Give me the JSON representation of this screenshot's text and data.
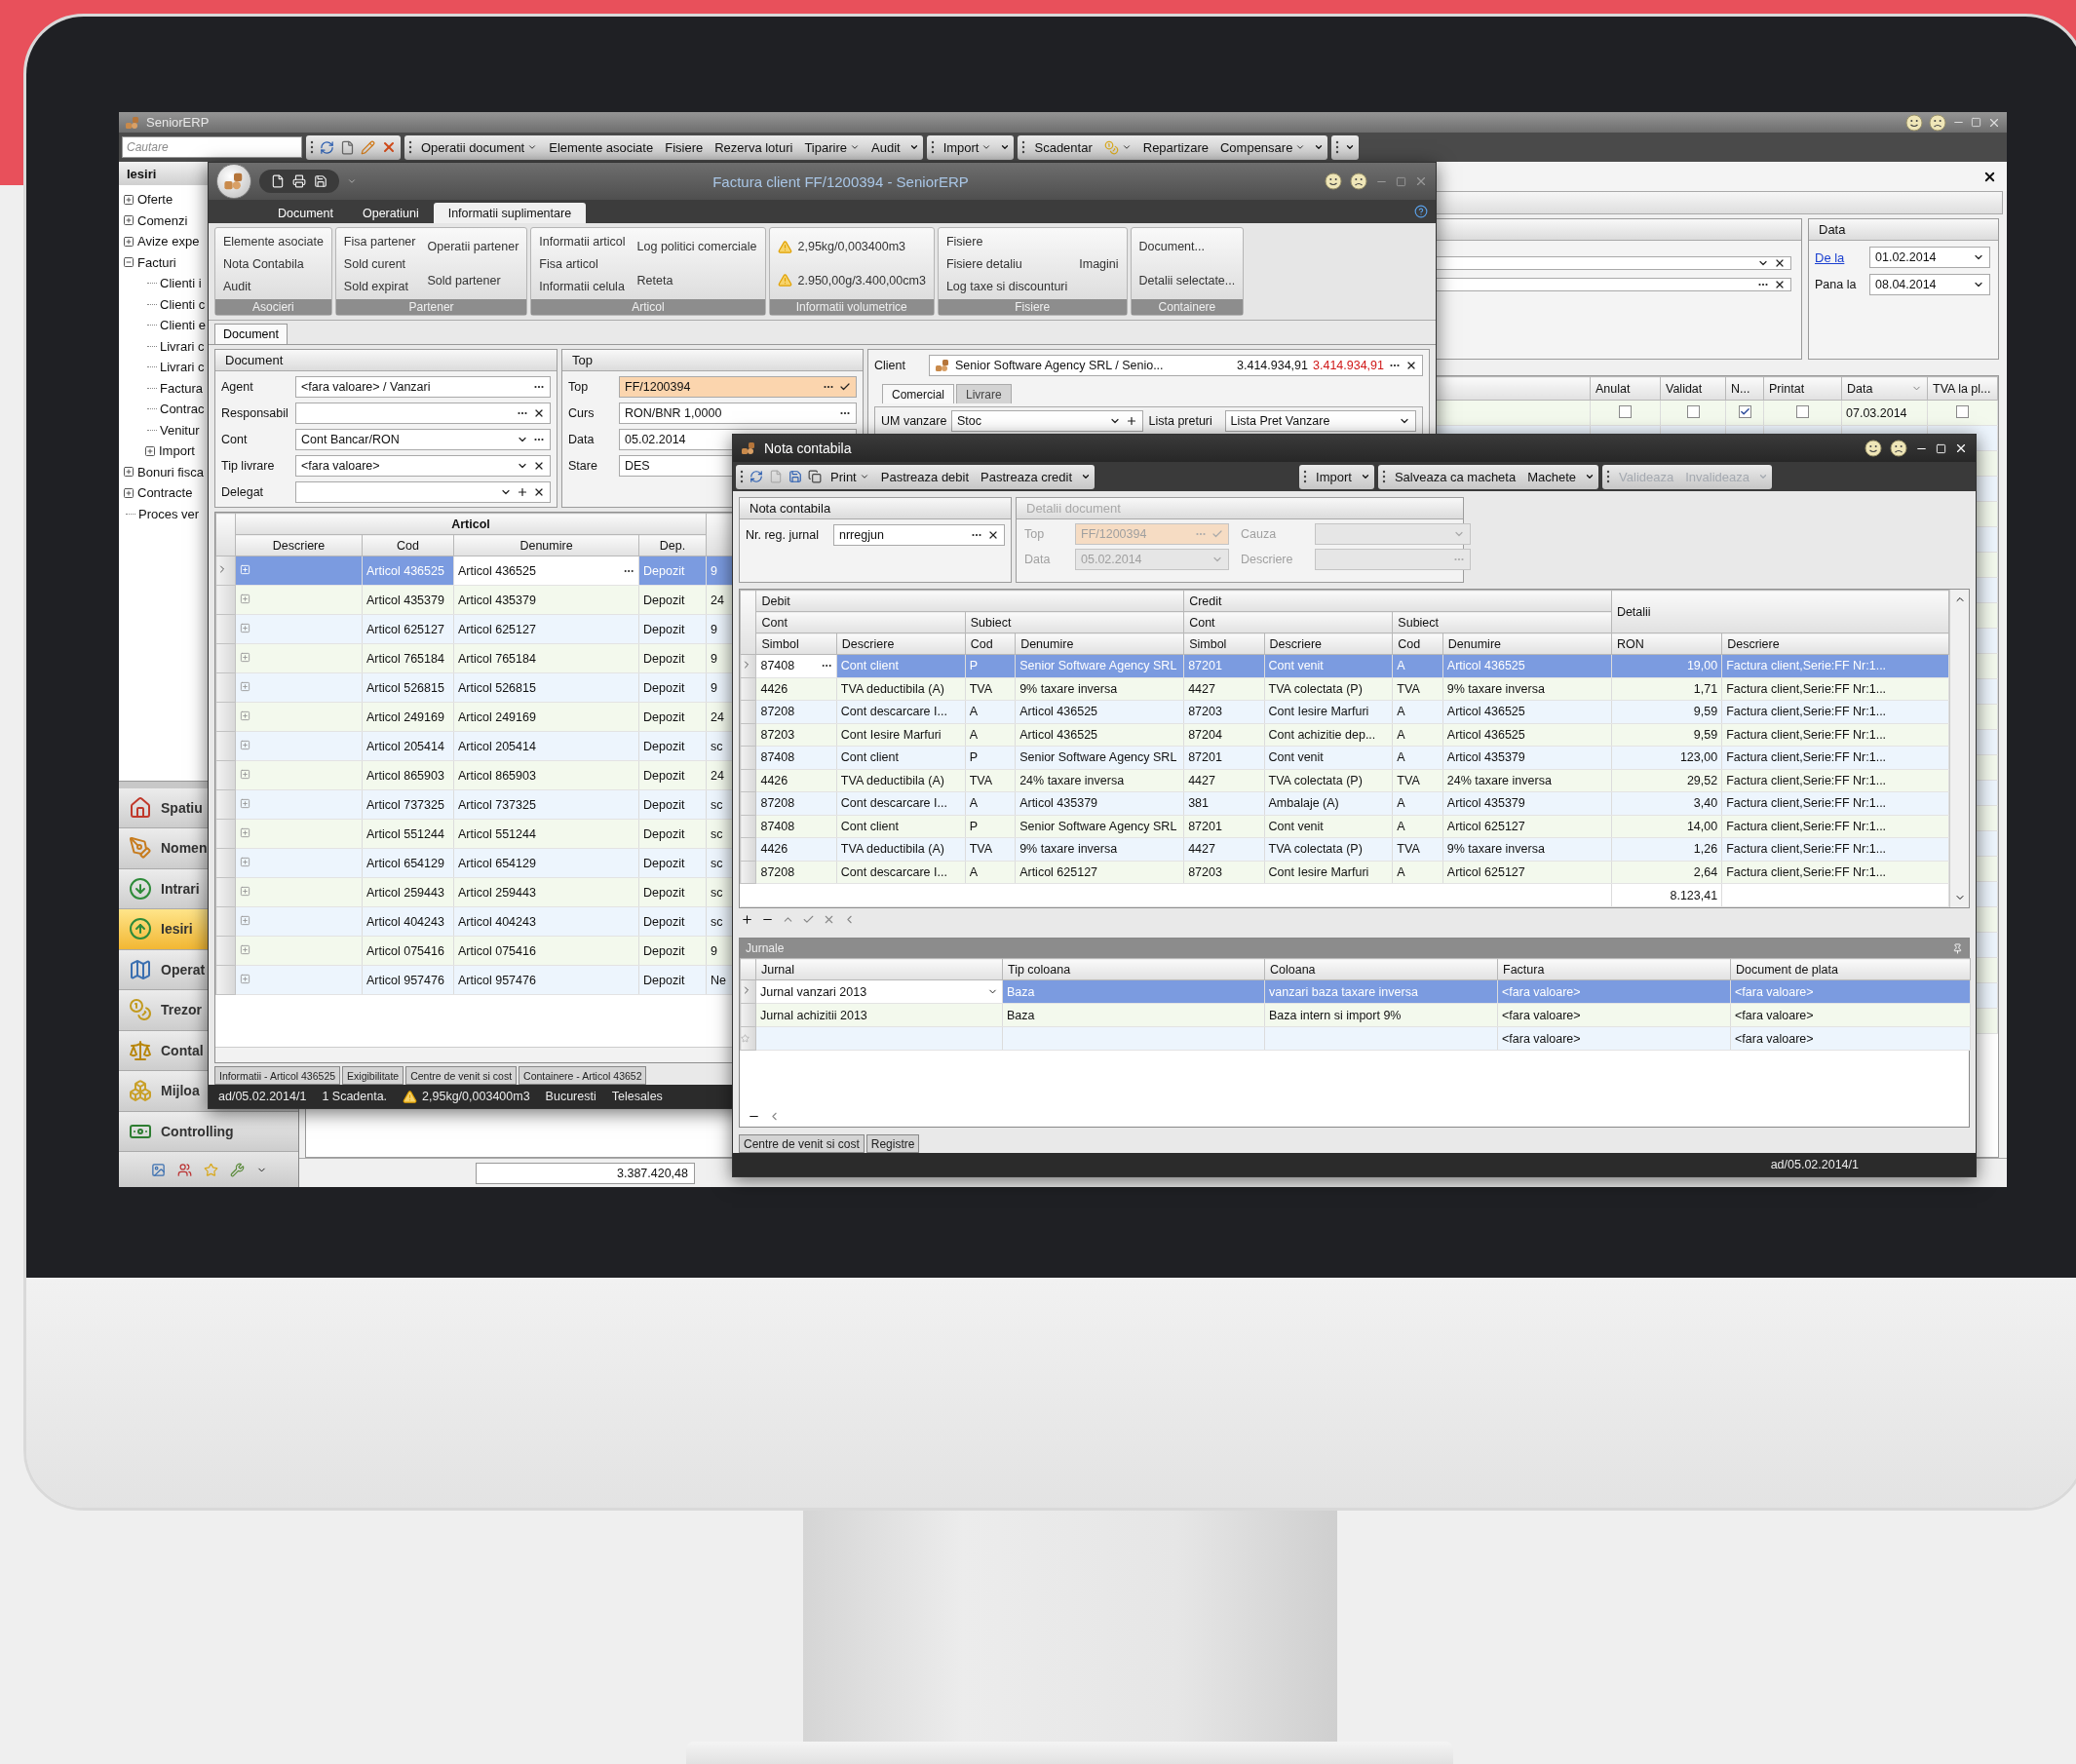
{
  "app": {
    "title": "SeniorERP",
    "search": {
      "placeholder": "Cautare"
    },
    "toolbar": [
      {
        "items": [
          {
            "kind": "text",
            "label": "Operatii document",
            "dropdown": true
          },
          {
            "kind": "text",
            "label": "Elemente asociate",
            "dropdown": false
          },
          {
            "kind": "text",
            "label": "Fisiere",
            "dropdown": false
          },
          {
            "kind": "text",
            "label": "Rezerva loturi",
            "dropdown": false
          },
          {
            "kind": "text",
            "label": "Tiparire",
            "dropdown": true
          },
          {
            "kind": "text",
            "label": "Audit",
            "dropdown": false
          }
        ]
      },
      {
        "items": [
          {
            "kind": "text",
            "label": "Import",
            "dropdown": true
          }
        ]
      },
      {
        "items": [
          {
            "kind": "text",
            "label": "Scadentar",
            "dropdown": false
          },
          {
            "kind": "icon",
            "dropdown": true
          },
          {
            "kind": "text",
            "label": "Repartizare",
            "dropdown": false
          },
          {
            "kind": "text",
            "label": "Compensare",
            "dropdown": true
          }
        ]
      }
    ],
    "nav": {
      "title": "Iesiri",
      "tree": [
        {
          "label": "Oferte",
          "expanded": false
        },
        {
          "label": "Comenzi",
          "expanded": false
        },
        {
          "label": "Avize expe",
          "expanded": false
        },
        {
          "label": "Facturi",
          "expanded": true,
          "children": [
            {
              "label": "Clienti i"
            },
            {
              "label": "Clienti c"
            },
            {
              "label": "Clienti e"
            },
            {
              "label": "Livrari c"
            },
            {
              "label": "Livrari c"
            },
            {
              "label": "Factura"
            },
            {
              "label": "Contrac"
            },
            {
              "label": "Venitur"
            },
            {
              "label": "Import",
              "expanded": false
            }
          ]
        },
        {
          "label": "Bonuri fisca",
          "expanded": false
        },
        {
          "label": "Contracte",
          "expanded": false
        },
        {
          "label": "Proces ver"
        }
      ]
    },
    "modules": [
      {
        "label": "Spatiu",
        "selected": false
      },
      {
        "label": "Nomen",
        "selected": false
      },
      {
        "label": "Intrari",
        "selected": false
      },
      {
        "label": "Iesiri",
        "selected": true
      },
      {
        "label": "Operat",
        "selected": false
      },
      {
        "label": "Trezor",
        "selected": false
      },
      {
        "label": "Contal",
        "selected": false
      },
      {
        "label": "Mijloa",
        "selected": false
      },
      {
        "label": "Controlling",
        "selected": false
      }
    ],
    "content": {
      "filter": {
        "fields": [
          {
            "buttons": [
              {
                "kind": "dropdown"
              },
              {
                "kind": "clear"
              }
            ]
          },
          {
            "buttons": [
              {
                "kind": "ellipsis"
              },
              {
                "kind": "clear"
              }
            ]
          }
        ],
        "date_group": {
          "title": "Data",
          "from_label": "De la",
          "from": "01.02.2014",
          "to_label": "Pana la",
          "to": "08.04.2014"
        }
      },
      "grid": {
        "columns": [
          "Anulat",
          "Validat",
          "N...",
          "Printat",
          "Data",
          "TVA la pl..."
        ],
        "rows": [
          {
            "cells": [
              {
                "kind": "check",
                "checked": false
              },
              {
                "kind": "check",
                "checked": false
              },
              {
                "kind": "check",
                "checked": true
              },
              {
                "kind": "check",
                "checked": false
              },
              {
                "kind": "text",
                "text": "07.03.2014"
              },
              {
                "kind": "check",
                "checked": false
              }
            ]
          }
        ],
        "total": "3.387.420,48"
      }
    }
  },
  "invoice": {
    "title": "Factura client FF/1200394 - SeniorERP",
    "ribbon_tabs": [
      {
        "label": "Document",
        "selected": false
      },
      {
        "label": "Operatiuni",
        "selected": false
      },
      {
        "label": "Informatii suplimentare",
        "selected": true
      }
    ],
    "ribbon_groups": [
      {
        "title": "Asocieri",
        "kind": "links",
        "columns": [
          [
            "Elemente asociate",
            "Nota Contabila",
            "Audit"
          ]
        ]
      },
      {
        "title": "Partener",
        "kind": "links",
        "columns": [
          [
            "Fisa partener",
            "Sold curent",
            "Sold expirat"
          ],
          [
            "Operatii partener",
            "Sold partener"
          ]
        ]
      },
      {
        "title": "Articol",
        "kind": "links",
        "columns": [
          [
            "Informatii articol",
            "Fisa articol",
            "Informatii celula"
          ],
          [
            "Log politici comerciale",
            "Reteta"
          ]
        ]
      },
      {
        "title": "Informatii volumetrice",
        "kind": "warnings",
        "columns": [
          [
            "2,95kg/0,003400m3",
            "2.950,00g/3.400,00cm3"
          ]
        ]
      },
      {
        "title": "Fisiere",
        "kind": "links",
        "columns": [
          [
            "Fisiere",
            "Fisiere detaliu",
            "Log taxe si discounturi"
          ],
          [
            "Imagini"
          ]
        ]
      },
      {
        "title": "Containere",
        "kind": "links",
        "columns": [
          [
            "Document...",
            "Detalii selectate..."
          ]
        ]
      }
    ],
    "doc_tab": "Document",
    "document_panel": {
      "title": "Document",
      "fields": [
        {
          "label": "Agent",
          "value": "<fara valoare> / Vanzari",
          "buttons": [
            {
              "kind": "ellipsis"
            }
          ]
        },
        {
          "label": "Responsabil",
          "buttons": [
            {
              "kind": "ellipsis"
            },
            {
              "kind": "clear"
            }
          ]
        },
        {
          "label": "Cont",
          "value": "Cont Bancar/RON",
          "buttons": [
            {
              "kind": "dropdown"
            },
            {
              "kind": "ellipsis"
            }
          ]
        },
        {
          "label": "Tip livrare",
          "value": "<fara valoare>",
          "buttons": [
            {
              "kind": "dropdown"
            },
            {
              "kind": "clear"
            }
          ]
        },
        {
          "label": "Delegat",
          "buttons": [
            {
              "kind": "dropdown"
            },
            {
              "kind": "add"
            },
            {
              "kind": "clear"
            }
          ]
        }
      ]
    },
    "top_panel": {
      "title": "Top",
      "fields": [
        {
          "label": "Top",
          "value": "FF/1200394",
          "highlighted": true,
          "buttons": [
            {
              "kind": "ellipsis"
            },
            {
              "kind": "check"
            }
          ]
        },
        {
          "label": "Curs",
          "value": "RON/BNR 1,0000",
          "highlighted": false,
          "buttons": [
            {
              "kind": "ellipsis"
            }
          ]
        },
        {
          "label": "Data",
          "value": "05.02.2014",
          "highlighted": false
        },
        {
          "label": "Stare",
          "value": "DES",
          "highlighted": false
        }
      ]
    },
    "client_panel": {
      "label": "Client",
      "name": "Senior Software Agency SRL / Senio...",
      "balance": "3.414.934,91",
      "overdue": "3.414.934,91",
      "buttons": [
        {
          "kind": "ellipsis"
        },
        {
          "kind": "clear"
        }
      ],
      "tabs": [
        {
          "label": "Comercial",
          "selected": true
        },
        {
          "label": "Livrare",
          "selected": false
        }
      ],
      "fields": [
        {
          "label": "UM vanzare",
          "value": "Stoc",
          "buttons": [
            {
              "kind": "dropdown"
            },
            {
              "kind": "add"
            }
          ]
        },
        {
          "label": "Lista preturi",
          "value": "Lista Pret Vanzare",
          "buttons": [
            {
              "kind": "dropdown"
            }
          ]
        }
      ]
    },
    "articles": {
      "group": "Articol",
      "columns": [
        "Descriere",
        "Cod",
        "Denumire",
        "Dep."
      ],
      "rows": [
        {
          "selected": true,
          "cod": "Articol 436525",
          "denumire": "Articol 436525",
          "dep": "Depozit",
          "column_5": "9"
        },
        {
          "selected": false,
          "cod": "Articol 435379",
          "denumire": "Articol 435379",
          "dep": "Depozit",
          "column_5": "24"
        },
        {
          "selected": false,
          "cod": "Articol 625127",
          "denumire": "Articol 625127",
          "dep": "Depozit",
          "column_5": "9"
        },
        {
          "selected": false,
          "cod": "Articol 765184",
          "denumire": "Articol 765184",
          "dep": "Depozit",
          "column_5": "9"
        },
        {
          "selected": false,
          "cod": "Articol 526815",
          "denumire": "Articol 526815",
          "dep": "Depozit",
          "column_5": "9"
        },
        {
          "selected": false,
          "cod": "Articol 249169",
          "denumire": "Articol 249169",
          "dep": "Depozit",
          "column_5": "24"
        },
        {
          "selected": false,
          "cod": "Articol 205414",
          "denumire": "Articol 205414",
          "dep": "Depozit",
          "column_5": "sc"
        },
        {
          "selected": false,
          "cod": "Articol 865903",
          "denumire": "Articol 865903",
          "dep": "Depozit",
          "column_5": "24"
        },
        {
          "selected": false,
          "cod": "Articol 737325",
          "denumire": "Articol 737325",
          "dep": "Depozit",
          "column_5": "sc"
        },
        {
          "selected": false,
          "cod": "Articol 551244",
          "denumire": "Articol 551244",
          "dep": "Depozit",
          "column_5": "sc"
        },
        {
          "selected": false,
          "cod": "Articol 654129",
          "denumire": "Articol 654129",
          "dep": "Depozit",
          "column_5": "sc"
        },
        {
          "selected": false,
          "cod": "Articol 259443",
          "denumire": "Articol 259443",
          "dep": "Depozit",
          "column_5": "sc"
        },
        {
          "selected": false,
          "cod": "Articol 404243",
          "denumire": "Articol 404243",
          "dep": "Depozit",
          "column_5": "sc"
        },
        {
          "selected": false,
          "cod": "Articol 075416",
          "denumire": "Articol 075416",
          "dep": "Depozit",
          "column_5": "9"
        },
        {
          "selected": false,
          "cod": "Articol 957476",
          "denumire": "Articol 957476",
          "dep": "Depozit",
          "column_5": "Ne"
        }
      ]
    },
    "bottom_tabs": [
      "Informatii - Articol 436525",
      "Exigibilitate",
      "Centre de venit si cost",
      "Containere - Articol 43652"
    ],
    "status": [
      {
        "kind": "plain",
        "text": "ad/05.02.2014/1"
      },
      {
        "kind": "plain",
        "text": "1 Scadenta."
      },
      {
        "kind": "warning",
        "text": "2,95kg/0,003400m3"
      },
      {
        "kind": "plain",
        "text": "Bucuresti"
      },
      {
        "kind": "plain",
        "text": "Telesales"
      }
    ]
  },
  "journal": {
    "title": "Nota contabila",
    "toolbar": [
      {
        "disabled": false,
        "items": [
          {
            "kind": "text",
            "label": "Print",
            "dropdown": true
          },
          {
            "kind": "text",
            "label": "Pastreaza debit",
            "dropdown": false
          },
          {
            "kind": "text",
            "label": "Pastreaza credit",
            "dropdown": false
          }
        ]
      },
      {
        "disabled": false,
        "items": [
          {
            "kind": "text",
            "label": "Import",
            "dropdown": false
          }
        ]
      },
      {
        "disabled": false,
        "items": [
          {
            "kind": "text",
            "label": "Salveaza ca macheta",
            "dropdown": false
          },
          {
            "kind": "text",
            "label": "Machete",
            "dropdown": false
          }
        ]
      },
      {
        "disabled": true,
        "items": [
          {
            "kind": "text",
            "label": "Valideaza",
            "dropdown": false
          },
          {
            "kind": "text",
            "label": "Invalideaza",
            "dropdown": false
          }
        ]
      }
    ],
    "header_panel": {
      "title": "Nota contabila",
      "label": "Nr. reg. jurnal",
      "value": "nrregjun",
      "buttons": [
        {
          "kind": "ellipsis"
        },
        {
          "kind": "clear"
        }
      ]
    },
    "details_panel": {
      "title": "Detalii document",
      "disabled": true,
      "fields": [
        {
          "label": "Top",
          "value": "FF/1200394",
          "highlighted": true,
          "buttons": [
            {
              "kind": "ellipsis"
            },
            {
              "kind": "check"
            }
          ]
        },
        {
          "label": "Cauza",
          "highlighted": false,
          "buttons": [
            {
              "kind": "dropdown"
            }
          ]
        },
        {
          "label": "Data",
          "value": "05.02.2014",
          "highlighted": false,
          "buttons": [
            {
              "kind": "dropdown"
            }
          ]
        },
        {
          "label": "Descriere",
          "highlighted": false,
          "buttons": [
            {
              "kind": "ellipsis"
            }
          ]
        }
      ]
    },
    "entries": {
      "bands": [
        {
          "label": "Debit",
          "groups": [
            {
              "label": "Cont",
              "columns": [
                "Simbol",
                "Descriere"
              ]
            },
            {
              "label": "Subiect",
              "columns": [
                "Cod",
                "Denumire"
              ]
            }
          ]
        },
        {
          "label": "Credit",
          "groups": [
            {
              "label": "Cont",
              "columns": [
                "Simbol",
                "Descriere"
              ]
            },
            {
              "label": "Subiect",
              "columns": [
                "Cod",
                "Denumire"
              ]
            }
          ]
        },
        {
          "label": "Detalii",
          "columns": [
            "RON",
            "Descriere"
          ]
        }
      ],
      "rows": [
        {
          "selected": true,
          "cells": [
            "87408",
            "Cont client",
            "P",
            "Senior Software Agency SRL",
            "87201",
            "Cont venit",
            "A",
            "Articol 436525",
            "19,00",
            "Factura client,Serie:FF Nr:1..."
          ]
        },
        {
          "selected": false,
          "cells": [
            "4426",
            "TVA deductibila (A)",
            "TVA",
            "9% taxare inversa",
            "4427",
            "TVA colectata (P)",
            "TVA",
            "9% taxare inversa",
            "1,71",
            "Factura client,Serie:FF Nr:1..."
          ]
        },
        {
          "selected": false,
          "cells": [
            "87208",
            "Cont descarcare I...",
            "A",
            "Articol 436525",
            "87203",
            "Cont Iesire Marfuri",
            "A",
            "Articol 436525",
            "9,59",
            "Factura client,Serie:FF Nr:1..."
          ]
        },
        {
          "selected": false,
          "cells": [
            "87203",
            "Cont Iesire Marfuri",
            "A",
            "Articol 436525",
            "87204",
            "Cont achizitie dep...",
            "A",
            "Articol 436525",
            "9,59",
            "Factura client,Serie:FF Nr:1..."
          ]
        },
        {
          "selected": false,
          "cells": [
            "87408",
            "Cont client",
            "P",
            "Senior Software Agency SRL",
            "87201",
            "Cont venit",
            "A",
            "Articol 435379",
            "123,00",
            "Factura client,Serie:FF Nr:1..."
          ]
        },
        {
          "selected": false,
          "cells": [
            "4426",
            "TVA deductibila (A)",
            "TVA",
            "24% taxare inversa",
            "4427",
            "TVA colectata (P)",
            "TVA",
            "24% taxare inversa",
            "29,52",
            "Factura client,Serie:FF Nr:1..."
          ]
        },
        {
          "selected": false,
          "cells": [
            "87208",
            "Cont descarcare I...",
            "A",
            "Articol 435379",
            "381",
            "Ambalaje (A)",
            "A",
            "Articol 435379",
            "3,40",
            "Factura client,Serie:FF Nr:1..."
          ]
        },
        {
          "selected": false,
          "cells": [
            "87408",
            "Cont client",
            "P",
            "Senior Software Agency SRL",
            "87201",
            "Cont venit",
            "A",
            "Articol 625127",
            "14,00",
            "Factura client,Serie:FF Nr:1..."
          ]
        },
        {
          "selected": false,
          "cells": [
            "4426",
            "TVA deductibila (A)",
            "TVA",
            "9% taxare inversa",
            "4427",
            "TVA colectata (P)",
            "TVA",
            "9% taxare inversa",
            "1,26",
            "Factura client,Serie:FF Nr:1..."
          ]
        },
        {
          "selected": false,
          "cells": [
            "87208",
            "Cont descarcare I...",
            "A",
            "Articol 625127",
            "87203",
            "Cont Iesire Marfuri",
            "A",
            "Articol 625127",
            "2,64",
            "Factura client,Serie:FF Nr:1..."
          ]
        }
      ],
      "total": "8.123,41"
    },
    "journals": {
      "title": "Jurnale",
      "columns": [
        "Jurnal",
        "Tip coloana",
        "Coloana",
        "Factura",
        "Document de plata"
      ],
      "rows": [
        {
          "kind": "row",
          "selected": true,
          "cells": [
            "Jurnal vanzari 2013",
            "Baza",
            "vanzari baza taxare inversa",
            "<fara valoare>",
            "<fara valoare>"
          ]
        },
        {
          "kind": "row",
          "selected": false,
          "cells": [
            "Jurnal achizitii 2013",
            "Baza",
            "Baza  intern si import 9%",
            "<fara valoare>",
            "<fara valoare>"
          ]
        },
        {
          "kind": "new",
          "selected": false,
          "cells": [
            null,
            null,
            null,
            "<fara valoare>",
            "<fara valoare>"
          ]
        }
      ]
    },
    "bottom_tabs": [
      "Centre de venit si cost",
      "Registre"
    ],
    "status": "ad/05.02.2014/1"
  }
}
